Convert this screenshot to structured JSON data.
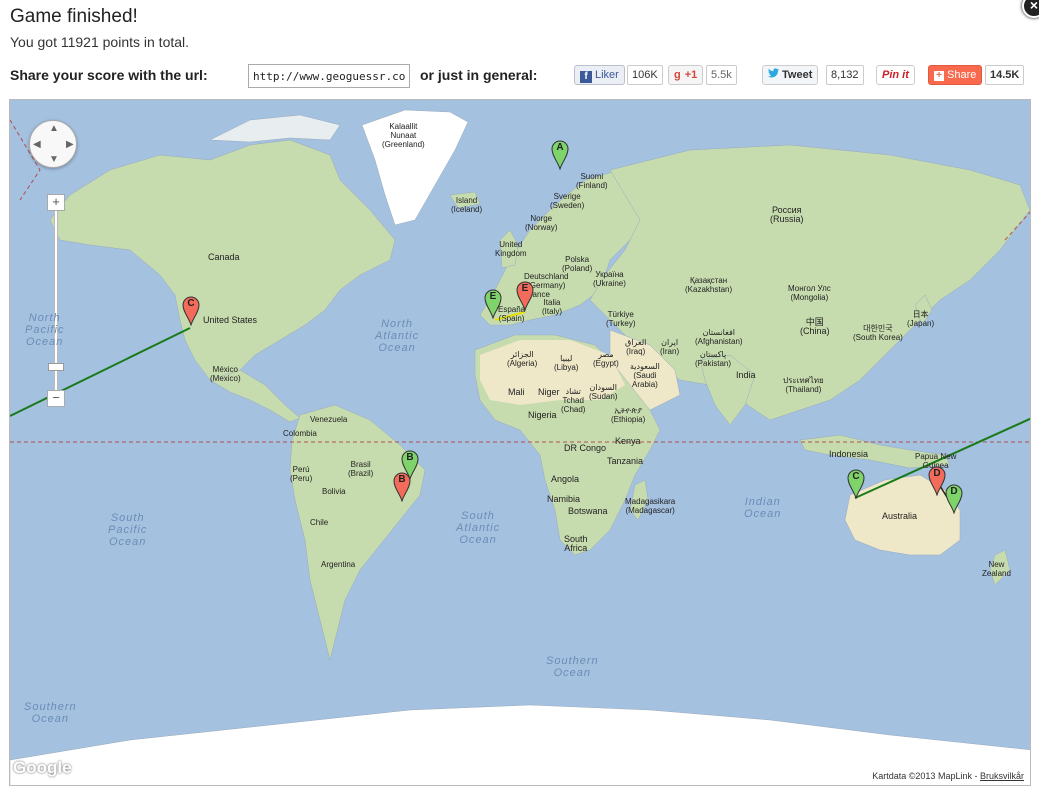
{
  "header": {
    "title": "Game finished!",
    "score_text": "You got 11921 points in total.",
    "close_label": "×"
  },
  "share": {
    "url_label": "Share your score with the url:",
    "url_value": "http://www.geoguessr.com",
    "general_label": "or just in general:",
    "facebook": {
      "label": "Liker",
      "icon": "f",
      "count": "106K"
    },
    "gplus": {
      "label": "+1",
      "icon": "g",
      "count": "5.5k"
    },
    "twitter": {
      "label": "Tweet",
      "count": "8,132"
    },
    "pinterest": {
      "label": "Pin it"
    },
    "addthis": {
      "label": "Share",
      "count": "14.5K"
    }
  },
  "map": {
    "zoom_in": "+",
    "zoom_out": "−",
    "google_logo": "Google",
    "attribution": "Kartdata ©2013 MapLink -",
    "terms_link": "Bruksvilkår",
    "labels": {
      "greenland": "Kalaallit\nNunaat\n(Greenland)",
      "iceland": "Island\n(Iceland)",
      "canada": "Canada",
      "usa": "United States",
      "mexico": "México\n(Mexico)",
      "venezuela": "Venezuela",
      "colombia": "Colombia",
      "peru": "Perú\n(Peru)",
      "brazil": "Brasil\n(Brazil)",
      "bolivia": "Bolivia",
      "chile": "Chile",
      "argentina": "Argentina",
      "finland": "Suomi\n(Finland)",
      "sweden": "Sverige\n(Sweden)",
      "norway": "Norge\n(Norway)",
      "uk": "United\nKingdom",
      "poland": "Polska\n(Poland)",
      "germany": "Deutschland\n(Germany)",
      "ukraine": "Україна\n(Ukraine)",
      "france": "France",
      "spain": "España\n(Spain)",
      "italy": "Italia\n(Italy)",
      "turkey": "Türkiye\n(Turkey)",
      "russia": "Россия\n(Russia)",
      "kazakhstan": "Қазақстан\n(Kazakhstan)",
      "mongolia": "Монгол Улс\n(Mongolia)",
      "china": "中国\n(China)",
      "japan": "日本\n(Japan)",
      "korea": "대한민국\n(South Korea)",
      "iraq": "العراق\n(Iraq)",
      "iran": "ایران\n(Iran)",
      "afghanistan": "افغانستان\n(Afghanistan)",
      "pakistan": "پاکستان\n(Pakistan)",
      "india": "India",
      "thailand": "ประเทศไทย\n(Thailand)",
      "algeria": "الجزائر\n(Algeria)",
      "libya": "ليبيا\n(Libya)",
      "egypt": "مصر\n(Egypt)",
      "saudi": "السعودية\n(Saudi\nArabia)",
      "mali": "Mali",
      "niger": "Niger",
      "chad": "تشاد\nTchad\n(Chad)",
      "sudan": "السودان\n(Sudan)",
      "nigeria": "Nigeria",
      "ethiopia": "ኢትዮጵያ\n(Ethiopia)",
      "drcongo": "DR Congo",
      "kenya": "Kenya",
      "tanzania": "Tanzania",
      "angola": "Angola",
      "namibia": "Namibia",
      "botswana": "Botswana",
      "madagascar": "Madagasikara\n(Madagascar)",
      "southafrica": "South\nAfrica",
      "indonesia": "Indonesia",
      "png": "Papua New\nGuinea",
      "australia": "Australia",
      "newzealand": "New\nZealand"
    },
    "oceans": {
      "north_pacific": "North\nPacific\nOcean",
      "north_atlantic": "North\nAtlantic\nOcean",
      "south_pacific": "South\nPacific\nOcean",
      "south_atlantic": "South\nAtlantic\nOcean",
      "indian": "Indian\nOcean",
      "southern": "Southern\nOcean",
      "southern_left": "Southern\nOcean"
    },
    "markers": [
      {
        "letter": "A",
        "color": "#7ed36a",
        "kind": "actual"
      },
      {
        "letter": "B",
        "color": "#7ed36a",
        "kind": "actual"
      },
      {
        "letter": "B",
        "color": "#f26b5b",
        "kind": "guess"
      },
      {
        "letter": "C",
        "color": "#f26b5b",
        "kind": "guess"
      },
      {
        "letter": "C",
        "color": "#7ed36a",
        "kind": "actual"
      },
      {
        "letter": "D",
        "color": "#f26b5b",
        "kind": "guess"
      },
      {
        "letter": "D",
        "color": "#7ed36a",
        "kind": "actual"
      },
      {
        "letter": "E",
        "color": "#7ed36a",
        "kind": "actual"
      },
      {
        "letter": "E",
        "color": "#f26b5b",
        "kind": "guess"
      }
    ],
    "colors": {
      "ocean": "#a4c1e0",
      "land": "#c7dcae",
      "desert": "#efe8c8",
      "ice": "#ffffff",
      "line": "#1a7a1a",
      "equator": "#b05050"
    }
  }
}
